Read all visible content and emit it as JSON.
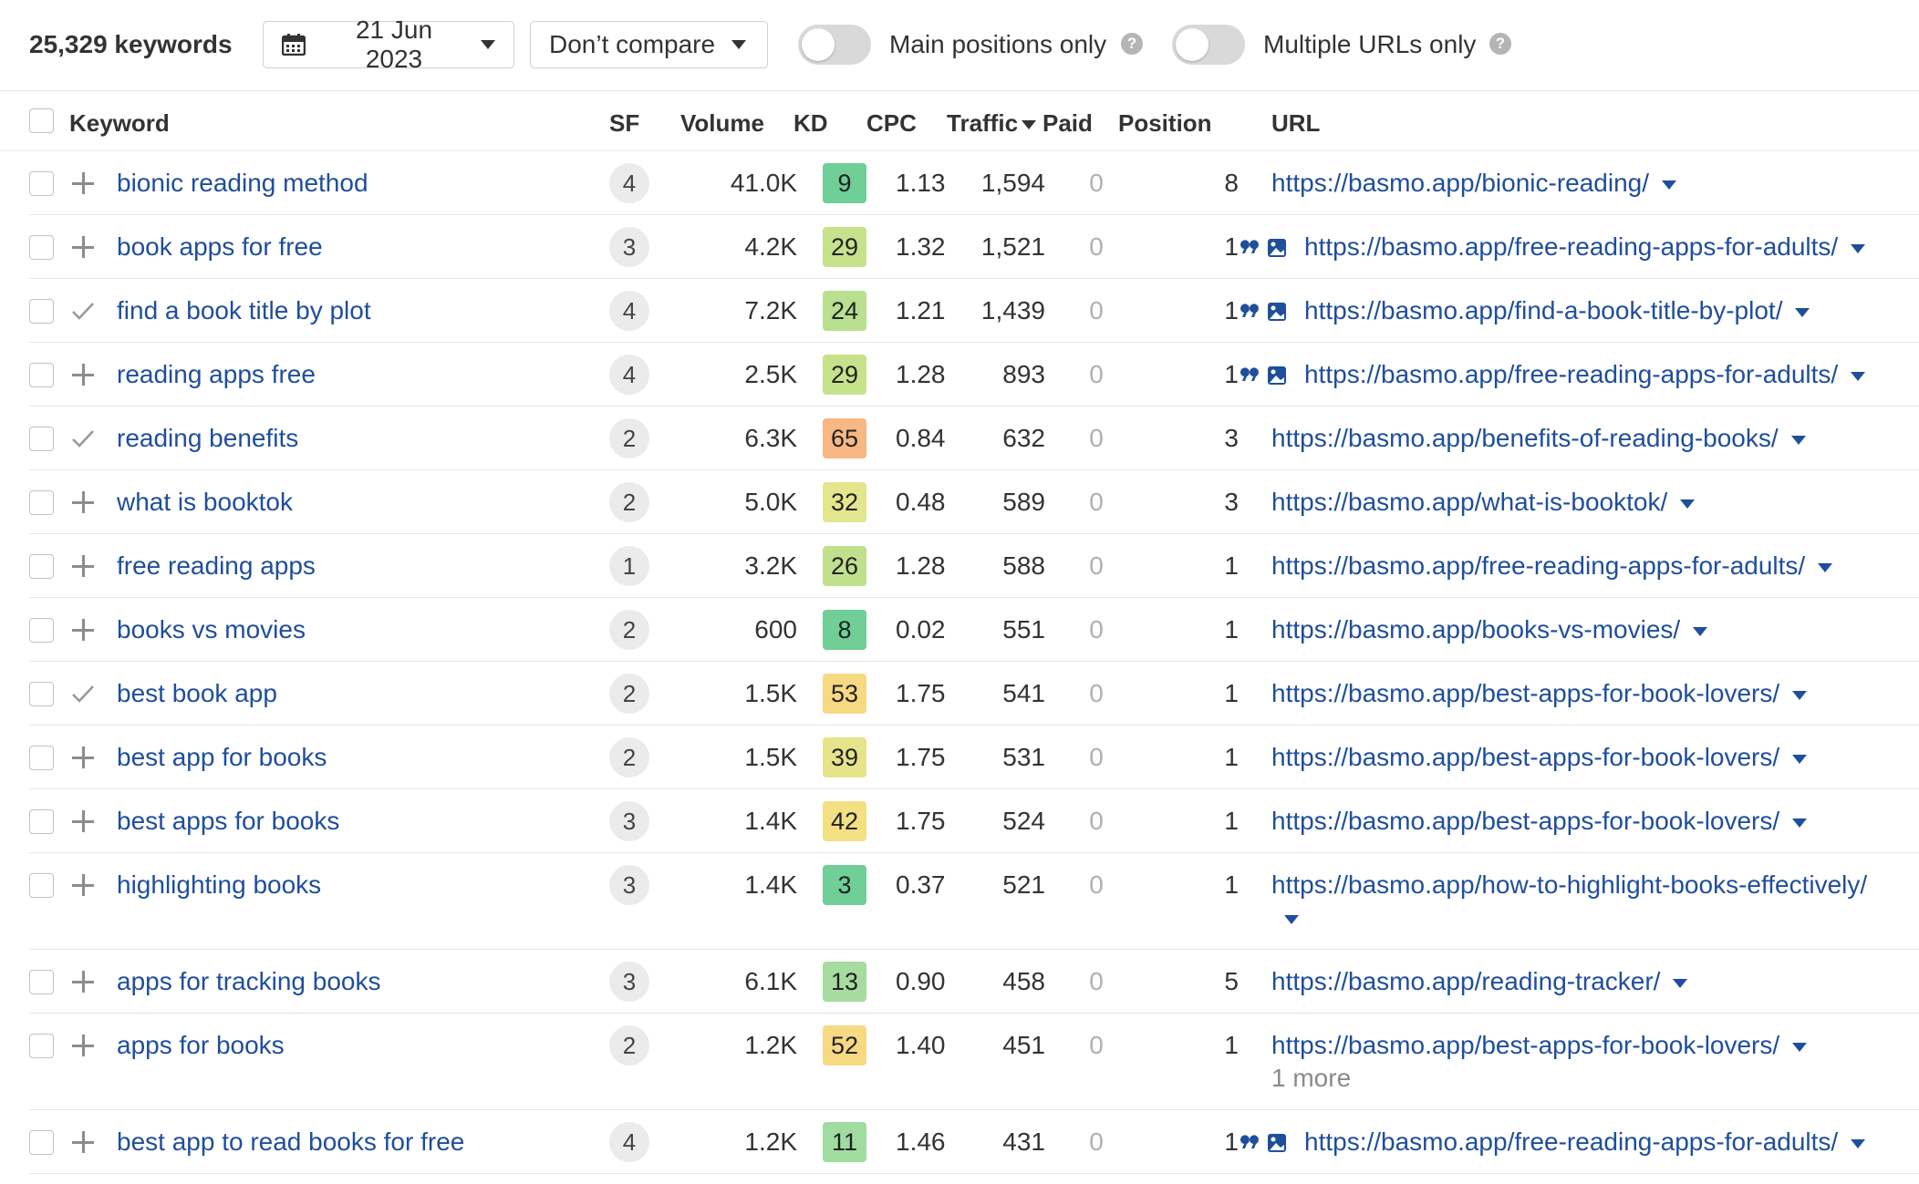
{
  "toolbar": {
    "keyword_count": "25,329 keywords",
    "date_label": "21 Jun 2023",
    "compare_label": "Don’t compare",
    "toggle_main_label": "Main positions only",
    "toggle_multi_label": "Multiple URLs only",
    "help_glyph": "?"
  },
  "table": {
    "headers": {
      "keyword": "Keyword",
      "sf": "SF",
      "volume": "Volume",
      "kd": "KD",
      "cpc": "CPC",
      "traffic": "Traffic",
      "paid": "Paid",
      "position": "Position",
      "url": "URL"
    },
    "rows": [
      {
        "keyword": "bionic reading method",
        "action": "plus",
        "sf": "4",
        "volume": "41.0K",
        "kd": "9",
        "kd_color": "#6fcf97",
        "cpc": "1.13",
        "traffic": "1,594",
        "paid": "0",
        "position": "8",
        "icons": false,
        "url": "https://basmo.app/bionic-reading/",
        "more": ""
      },
      {
        "keyword": "book apps for free",
        "action": "plus",
        "sf": "3",
        "volume": "4.2K",
        "kd": "29",
        "kd_color": "#c6e38c",
        "cpc": "1.32",
        "traffic": "1,521",
        "paid": "0",
        "position": "1",
        "icons": true,
        "url": "https://basmo.app/free-reading-apps-for-adults/",
        "more": ""
      },
      {
        "keyword": "find a book title by plot",
        "action": "check",
        "sf": "4",
        "volume": "7.2K",
        "kd": "24",
        "kd_color": "#b8e08e",
        "cpc": "1.21",
        "traffic": "1,439",
        "paid": "0",
        "position": "1",
        "icons": true,
        "url": "https://basmo.app/find-a-book-title-by-plot/",
        "more": ""
      },
      {
        "keyword": "reading apps free",
        "action": "plus",
        "sf": "4",
        "volume": "2.5K",
        "kd": "29",
        "kd_color": "#c6e38c",
        "cpc": "1.28",
        "traffic": "893",
        "paid": "0",
        "position": "1",
        "icons": true,
        "url": "https://basmo.app/free-reading-apps-for-adults/",
        "more": ""
      },
      {
        "keyword": "reading benefits",
        "action": "check",
        "sf": "2",
        "volume": "6.3K",
        "kd": "65",
        "kd_color": "#f7b883",
        "cpc": "0.84",
        "traffic": "632",
        "paid": "0",
        "position": "3",
        "icons": false,
        "url": "https://basmo.app/benefits-of-reading-books/",
        "more": ""
      },
      {
        "keyword": "what is booktok",
        "action": "plus",
        "sf": "2",
        "volume": "5.0K",
        "kd": "32",
        "kd_color": "#e3e68c",
        "cpc": "0.48",
        "traffic": "589",
        "paid": "0",
        "position": "3",
        "icons": false,
        "url": "https://basmo.app/what-is-booktok/",
        "more": ""
      },
      {
        "keyword": "free reading apps",
        "action": "plus",
        "sf": "1",
        "volume": "3.2K",
        "kd": "26",
        "kd_color": "#c0e08e",
        "cpc": "1.28",
        "traffic": "588",
        "paid": "0",
        "position": "1",
        "icons": false,
        "url": "https://basmo.app/free-reading-apps-for-adults/",
        "more": ""
      },
      {
        "keyword": "books vs movies",
        "action": "plus",
        "sf": "2",
        "volume": "600",
        "kd": "8",
        "kd_color": "#6fcf97",
        "cpc": "0.02",
        "traffic": "551",
        "paid": "0",
        "position": "1",
        "icons": false,
        "url": "https://basmo.app/books-vs-movies/",
        "more": ""
      },
      {
        "keyword": "best book app",
        "action": "check",
        "sf": "2",
        "volume": "1.5K",
        "kd": "53",
        "kd_color": "#f7d983",
        "cpc": "1.75",
        "traffic": "541",
        "paid": "0",
        "position": "1",
        "icons": false,
        "url": "https://basmo.app/best-apps-for-book-lovers/",
        "more": ""
      },
      {
        "keyword": "best app for books",
        "action": "plus",
        "sf": "2",
        "volume": "1.5K",
        "kd": "39",
        "kd_color": "#e6e48a",
        "cpc": "1.75",
        "traffic": "531",
        "paid": "0",
        "position": "1",
        "icons": false,
        "url": "https://basmo.app/best-apps-for-book-lovers/",
        "more": ""
      },
      {
        "keyword": "best apps for books",
        "action": "plus",
        "sf": "3",
        "volume": "1.4K",
        "kd": "42",
        "kd_color": "#f2e083",
        "cpc": "1.75",
        "traffic": "524",
        "paid": "0",
        "position": "1",
        "icons": false,
        "url": "https://basmo.app/best-apps-for-book-lovers/",
        "more": ""
      },
      {
        "keyword": "highlighting books",
        "action": "plus",
        "sf": "3",
        "volume": "1.4K",
        "kd": "3",
        "kd_color": "#6fcf97",
        "cpc": "0.37",
        "traffic": "521",
        "paid": "0",
        "position": "1",
        "icons": false,
        "url": "https://basmo.app/how-to-highlight-books-effectively/",
        "more": ""
      },
      {
        "keyword": "apps for tracking books",
        "action": "plus",
        "sf": "3",
        "volume": "6.1K",
        "kd": "13",
        "kd_color": "#a6dca0",
        "cpc": "0.90",
        "traffic": "458",
        "paid": "0",
        "position": "5",
        "icons": false,
        "url": "https://basmo.app/reading-tracker/",
        "more": ""
      },
      {
        "keyword": "apps for books",
        "action": "plus",
        "sf": "2",
        "volume": "1.2K",
        "kd": "52",
        "kd_color": "#f7d983",
        "cpc": "1.40",
        "traffic": "451",
        "paid": "0",
        "position": "1",
        "icons": false,
        "url": "https://basmo.app/best-apps-for-book-lovers/",
        "more": "1 more"
      },
      {
        "keyword": "best app to read books for free",
        "action": "plus",
        "sf": "4",
        "volume": "1.2K",
        "kd": "11",
        "kd_color": "#a0dca0",
        "cpc": "1.46",
        "traffic": "431",
        "paid": "0",
        "position": "1",
        "icons": true,
        "url": "https://basmo.app/free-reading-apps-for-adults/",
        "more": ""
      }
    ]
  },
  "colors": {
    "link": "#1f4e9c",
    "paid_text": "#b0b0b0",
    "sf_badge": "#ebebeb",
    "toggle_off": "#d9d9d9"
  }
}
